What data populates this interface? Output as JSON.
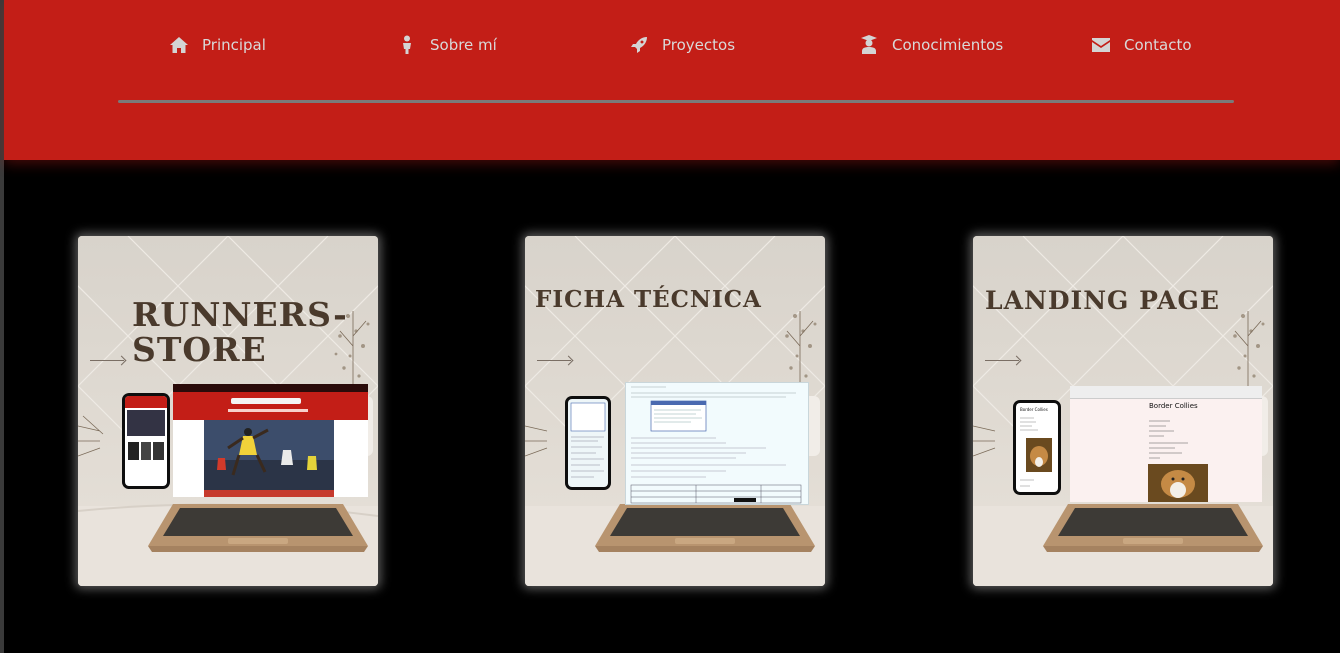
{
  "nav": {
    "items": [
      {
        "label": "Principal",
        "icon": "home-icon"
      },
      {
        "label": "Sobre mí",
        "icon": "person-icon"
      },
      {
        "label": "Proyectos",
        "icon": "rocket-icon"
      },
      {
        "label": "Conocimientos",
        "icon": "graduate-icon"
      },
      {
        "label": "Contacto",
        "icon": "envelope-icon"
      }
    ]
  },
  "projects": [
    {
      "title_line1": "RUNNERS-",
      "title_line2": "STORE",
      "image": "runners-store-mockup"
    },
    {
      "title_line1": "FICHA TÉCNICA",
      "image": "ficha-tecnica-mockup"
    },
    {
      "title_line1": "LANDING PAGE",
      "image": "landing-page-mockup",
      "screen_heading": "Border Collies",
      "phone_heading": "Border Collies"
    }
  ],
  "colors": {
    "header_bg": "#c31e17",
    "page_bg": "#000000",
    "title_color": "#4a3a2c",
    "nav_text": "#d9d9d9"
  }
}
